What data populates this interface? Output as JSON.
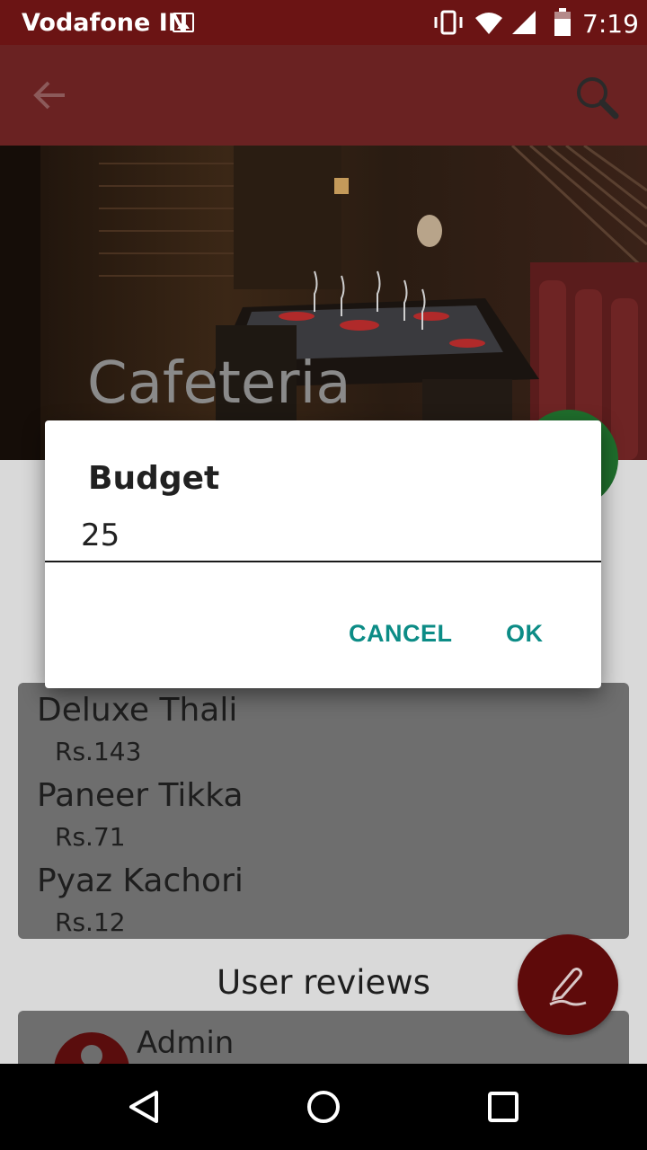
{
  "status_bar": {
    "carrier": "Vodafone IN",
    "time": "7:19",
    "icons": [
      "gallery-icon",
      "vibrate-icon",
      "wifi-icon",
      "signal-icon",
      "battery-icon"
    ]
  },
  "toolbar": {
    "icons": [
      "back-arrow-icon",
      "search-icon"
    ]
  },
  "hero": {
    "title": "Cafeteria"
  },
  "menu": {
    "items": [
      {
        "name": "Deluxe Thali",
        "price": "Rs.143"
      },
      {
        "name": "Paneer Tikka",
        "price": "Rs.71"
      },
      {
        "name": "Pyaz Kachori",
        "price": "Rs.12"
      }
    ]
  },
  "reviews": {
    "heading": "User reviews",
    "first_reviewer": "Admin"
  },
  "dialog": {
    "title": "Budget",
    "input_value": "25",
    "cancel_label": "CANCEL",
    "ok_label": "OK"
  },
  "colors": {
    "status_bar": "#6b1414",
    "toolbar": "#6a2222",
    "accent_button_text": "#0c8c86",
    "fab_edit": "#5e0a0a",
    "fab_green": "#1f6e2c"
  }
}
